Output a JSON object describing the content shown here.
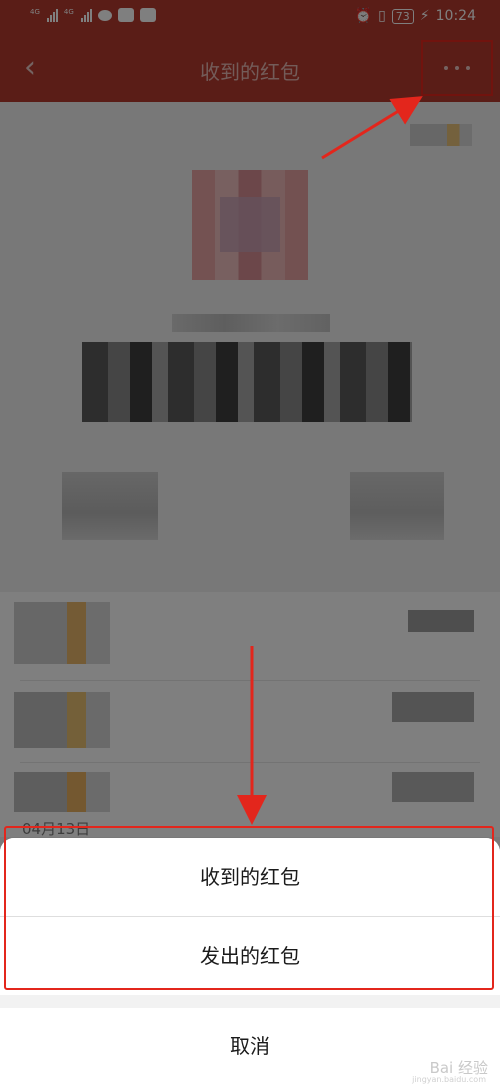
{
  "status_bar": {
    "net1": "4G",
    "net2": "4G",
    "battery": "73",
    "time": "10:24"
  },
  "nav": {
    "title": "收到的红包",
    "back_icon": "chevron-left-icon",
    "more_icon": "more-dots-icon"
  },
  "list": {
    "date_label": "04月13日"
  },
  "action_sheet": {
    "options": [
      "收到的红包",
      "发出的红包"
    ],
    "cancel": "取消"
  },
  "annotation_colors": {
    "highlight": "#e3261c"
  },
  "watermark": {
    "text": "Bai 经验",
    "sub": "jingyan.baidu.com"
  }
}
